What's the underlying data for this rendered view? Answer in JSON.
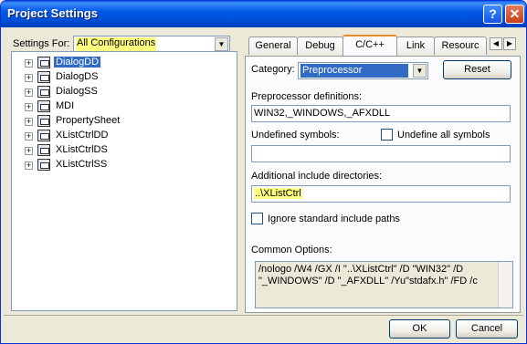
{
  "window": {
    "title": "Project Settings"
  },
  "titlebar": {
    "help_label": "?",
    "close_label": "✕"
  },
  "left": {
    "settings_for_label": "Settings For:",
    "settings_for_value": "All Configurations",
    "tree_items": [
      {
        "label": "DialogDD",
        "selected": true
      },
      {
        "label": "DialogDS",
        "selected": false
      },
      {
        "label": "DialogSS",
        "selected": false
      },
      {
        "label": "MDI",
        "selected": false
      },
      {
        "label": "PropertySheet",
        "selected": false
      },
      {
        "label": "XListCtrlDD",
        "selected": false
      },
      {
        "label": "XListCtrlDS",
        "selected": false
      },
      {
        "label": "XListCtrlSS",
        "selected": false
      }
    ]
  },
  "tabs": [
    "General",
    "Debug",
    "C/C++",
    "Link",
    "Resourc"
  ],
  "active_tab": "C/C++",
  "cpp": {
    "category_label": "Category:",
    "category_value": "Preprocessor",
    "reset_label": "Reset",
    "preproc_label": "Preprocessor definitions:",
    "preproc_value": "WIN32,_WINDOWS,_AFXDLL",
    "undef_label": "Undefined symbols:",
    "undef_value": "",
    "undefine_all_label": "Undefine all symbols",
    "include_label": "Additional include directories:",
    "include_value": "..\\XListCtrl",
    "ignore_label": "Ignore standard include paths",
    "common_label": "Common Options:",
    "common_value": "/nologo /W4 /GX /I \"..\\XListCtrl\" /D \"WIN32\" /D \"_WINDOWS\" /D \"_AFXDLL\" /Yu\"stdafx.h\" /FD /c"
  },
  "footer": {
    "ok_label": "OK",
    "cancel_label": "Cancel"
  },
  "icons": {
    "expander": "plus-box-icon",
    "project": "project-icon",
    "dropdown": "chevron-down-icon"
  },
  "colors": {
    "selection": "#316ac5",
    "highlight": "#ffff80",
    "titlebar": "#0058e6"
  }
}
